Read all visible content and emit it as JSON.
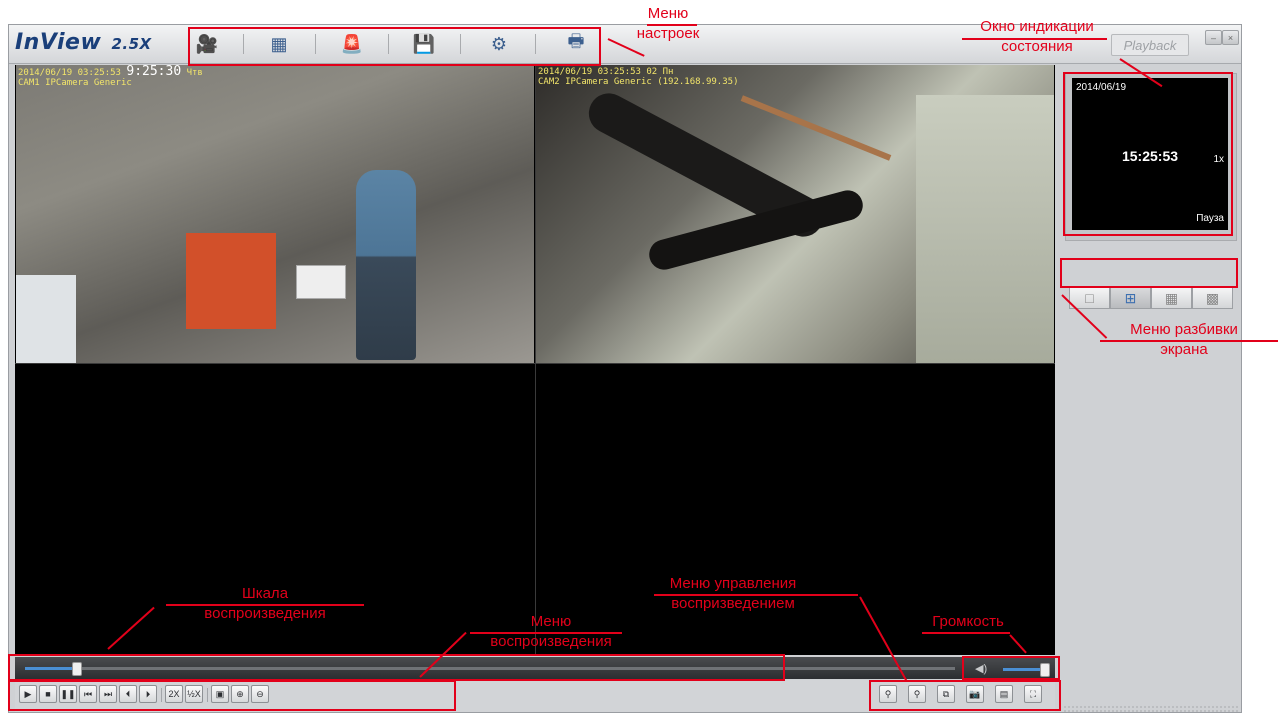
{
  "app": {
    "logo": "InView",
    "version": "2.5X",
    "playback_button": "Playback",
    "win_minimize": "–",
    "win_close": "×"
  },
  "toolbar": {
    "items": [
      {
        "name": "video-camera-icon",
        "glyph": "🎥"
      },
      {
        "name": "search-recording-icon",
        "glyph": "▦"
      },
      {
        "name": "alarm-search-icon",
        "glyph": "🚨"
      },
      {
        "name": "backup-icon",
        "glyph": "💾"
      },
      {
        "name": "settings-icon",
        "glyph": "⚙"
      },
      {
        "name": "print-icon",
        "glyph": "🖶"
      }
    ]
  },
  "cameras": [
    {
      "timestamp": "2014/06/19 03:25:53",
      "time_big": "9:25:30",
      "weekday": "Чтв",
      "label": "CAM1 IPCamera Generic"
    },
    {
      "timestamp": "2014/06/19 03:25:53",
      "time_big": "02",
      "weekday": "Пн",
      "label": "CAM2 IPCamera Generic (192.168.99.35)"
    }
  ],
  "status": {
    "date": "2014/06/19",
    "time": "15:25:53",
    "speed": "1x",
    "state": "Пауза"
  },
  "timeline": {
    "progress": 0.055
  },
  "volume": {
    "level": 0.9,
    "icon": "speaker-icon"
  },
  "playback_controls": [
    {
      "name": "play-button",
      "glyph": "▶"
    },
    {
      "name": "stop-button",
      "glyph": "■"
    },
    {
      "name": "pause-button",
      "glyph": "❚❚"
    },
    {
      "name": "rewind-start-button",
      "glyph": "⏮"
    },
    {
      "name": "forward-end-button",
      "glyph": "⏭"
    },
    {
      "name": "prev-frame-button",
      "glyph": "⏴"
    },
    {
      "name": "next-frame-button",
      "glyph": "⏵"
    }
  ],
  "speed_controls": [
    {
      "name": "speed-double-button",
      "glyph": "2X"
    },
    {
      "name": "speed-half-button",
      "glyph": "½X"
    }
  ],
  "view_controls": [
    {
      "name": "snapshot-view-button",
      "glyph": "▣"
    },
    {
      "name": "zoom-in-button",
      "glyph": "⊕"
    },
    {
      "name": "zoom-out-button",
      "glyph": "⊖"
    }
  ],
  "right_controls": [
    {
      "name": "mic-button",
      "glyph": "⚲"
    },
    {
      "name": "audio-button",
      "glyph": "⚲"
    },
    {
      "name": "record-window-button",
      "glyph": "⧉"
    },
    {
      "name": "camera-snapshot-button",
      "glyph": "📷"
    },
    {
      "name": "fit-screen-button",
      "glyph": "▤"
    },
    {
      "name": "fullscreen-button",
      "glyph": "⛶"
    }
  ],
  "split_modes": [
    {
      "name": "split-1-button",
      "glyph": "□",
      "active": false
    },
    {
      "name": "split-4-button",
      "glyph": "⊞",
      "active": true
    },
    {
      "name": "split-9-button",
      "glyph": "▦",
      "active": false
    },
    {
      "name": "split-16-button",
      "glyph": "▩",
      "active": false
    }
  ],
  "annotations": {
    "settings_menu": [
      "Меню",
      "настроек"
    ],
    "status_window": [
      "Окно индикации",
      "состояния"
    ],
    "split_menu": [
      "Меню разбивки",
      "экрана"
    ],
    "timeline_scale": [
      "Шкала",
      "воспроизведения"
    ],
    "playback_menu": [
      "Меню",
      "воспроизведения"
    ],
    "playback_control_menu": [
      "Меню управления",
      "воспризведением"
    ],
    "volume": [
      "Громкость"
    ]
  },
  "colors": {
    "annotation": "#e2001a",
    "accent": "#4a8fd4"
  }
}
